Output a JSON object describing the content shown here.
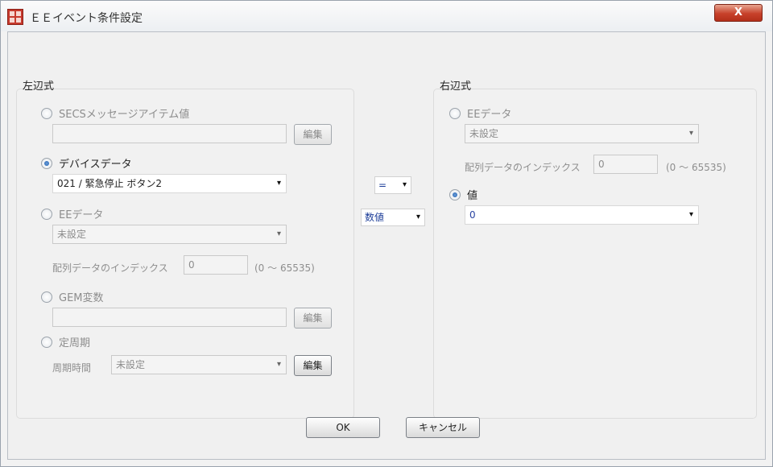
{
  "window": {
    "title": "ＥＥイベント条件設定",
    "close_label": "X"
  },
  "left_group": {
    "title": "左辺式",
    "secs": {
      "label": "SECSメッセージアイテム値",
      "value": "",
      "edit_label": "編集"
    },
    "device": {
      "label": "デバイスデータ",
      "selected": "021 / 緊急停止 ボタン2"
    },
    "ee_data": {
      "label": "EEデータ",
      "selected": "未設定",
      "index_label": "配列データのインデックス",
      "index_value": "0",
      "range": "(0 ～ 65535)"
    },
    "gem": {
      "label": "GEM変数",
      "value": "",
      "edit_label": "編集"
    },
    "timer": {
      "label": "定周期",
      "period_label": "周期時間",
      "selected": "未設定",
      "edit_label": "編集"
    }
  },
  "operators": {
    "compare": "=",
    "type": "数値"
  },
  "right_group": {
    "title": "右辺式",
    "ee_data": {
      "label": "EEデータ",
      "selected": "未設定",
      "index_label": "配列データのインデックス",
      "index_value": "0",
      "range": "(0 ～ 65535)"
    },
    "value": {
      "label": "値",
      "selected": "0"
    }
  },
  "footer": {
    "ok_label": "OK",
    "cancel_label": "キャンセル"
  },
  "icons": {
    "dropdown": "▾",
    "app": "grid-window-icon",
    "close": "close-icon"
  },
  "colors": {
    "close_button": "#c7412a",
    "selected_radio": "#1f5fb1",
    "value_text": "#2b45a2"
  }
}
